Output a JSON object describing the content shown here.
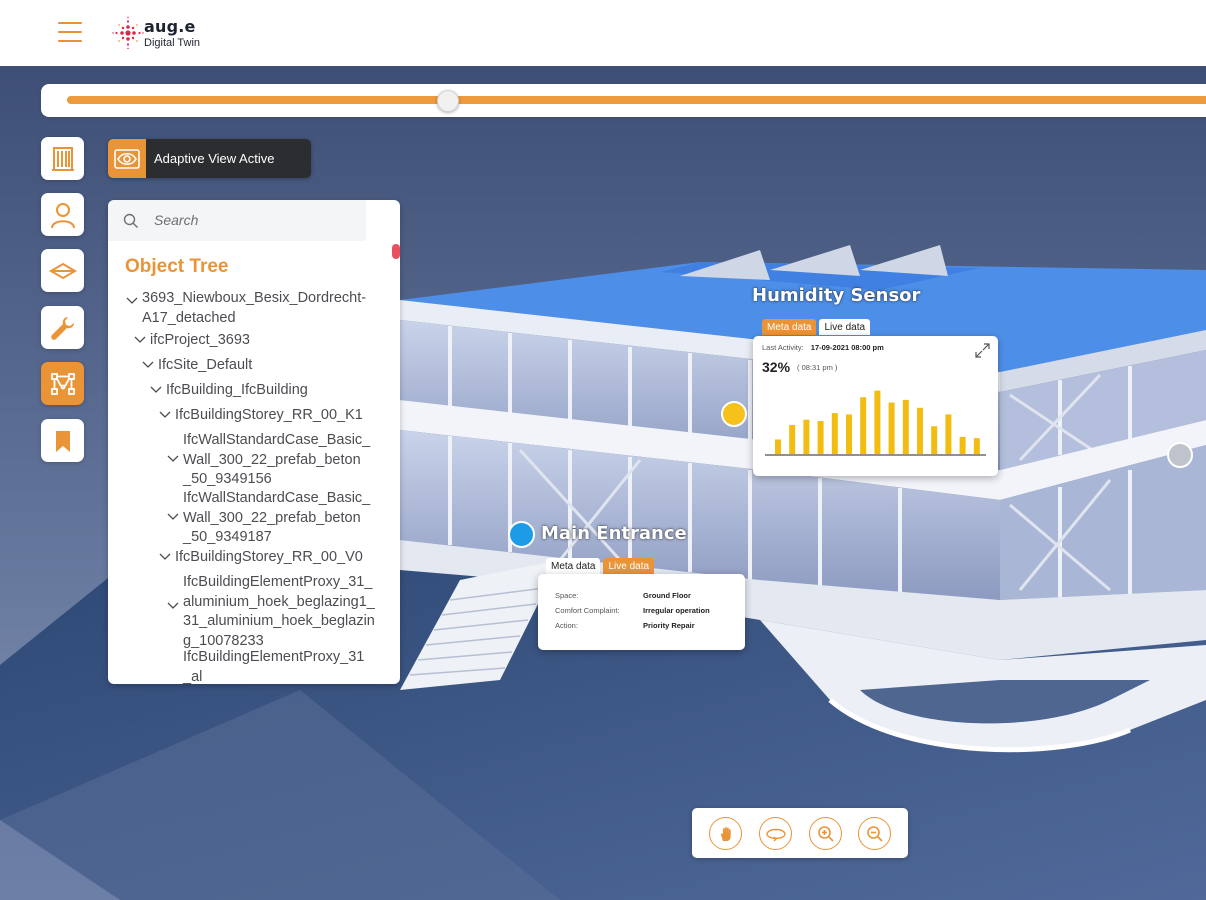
{
  "header": {
    "menu_icon": "hamburger-icon",
    "brand_name": "aug.e",
    "brand_subtitle": "Digital Twin",
    "brand_color": "#ea9438"
  },
  "timeline": {
    "position_fraction": 0.33,
    "track_color": "#ec9a3c"
  },
  "toolbar": {
    "items": [
      {
        "icon": "building-icon",
        "active": false
      },
      {
        "icon": "user-icon",
        "active": false
      },
      {
        "icon": "layers-icon",
        "active": false
      },
      {
        "icon": "wrench-icon",
        "active": false
      },
      {
        "icon": "network-icon",
        "active": true
      },
      {
        "icon": "bookmark-icon",
        "active": false
      }
    ]
  },
  "adaptive_view": {
    "icon": "eye-icon",
    "label": "Adaptive View Active"
  },
  "object_tree": {
    "search_placeholder": "Search",
    "title": "Object Tree",
    "nodes": [
      {
        "lines": [
          "3693_Niewboux_Besix_Dordrecht-",
          "A17_detached"
        ],
        "depth": 0,
        "expanded": true
      },
      {
        "lines": [
          "ifcProject_3693"
        ],
        "depth": 1,
        "expanded": true
      },
      {
        "lines": [
          "IfcSite_Default"
        ],
        "depth": 2,
        "expanded": true
      },
      {
        "lines": [
          "IfcBuilding_IfcBuilding"
        ],
        "depth": 3,
        "expanded": true
      },
      {
        "lines": [
          "IfcBuildingStorey_RR_00_K1"
        ],
        "depth": 4,
        "expanded": true
      },
      {
        "lines": [
          "IfcWallStandardCase_Basic_",
          "Wall_300_22_prefab_beton",
          "_50_9349156"
        ],
        "depth": 5,
        "expanded": true
      },
      {
        "lines": [
          "IfcWallStandardCase_Basic_",
          "Wall_300_22_prefab_beton",
          "_50_9349187"
        ],
        "depth": 5,
        "expanded": true
      },
      {
        "lines": [
          "IfcBuildingStorey_RR_00_V0"
        ],
        "depth": 4,
        "expanded": true
      },
      {
        "lines": [
          "IfcBuildingElementProxy_31_",
          "aluminium_hoek_beglazing1_",
          "31_aluminium_hoek_beglazin",
          "g_10078233"
        ],
        "depth": 5,
        "expanded": true
      },
      {
        "lines": [
          "IfcBuildingElementProxy_31",
          "_al"
        ],
        "depth": 5,
        "expanded": false
      }
    ]
  },
  "humidity_sensor": {
    "title": "Humidity Sensor",
    "tab_meta": "Meta data",
    "tab_live": "Live data",
    "active_tab": "meta",
    "last_activity_label": "Last Activity:",
    "last_activity_value": "17-09-2021 08:00 pm",
    "value": "32%",
    "time": "( 08:31 pm )",
    "expand_icon": "expand-icon",
    "marker_color": "#f5c21b",
    "bar_color": "#f2bc13"
  },
  "chart_data": {
    "type": "bar",
    "values": [
      2.2,
      4.4,
      5.2,
      5.0,
      6.2,
      6.0,
      8.6,
      9.6,
      7.8,
      8.2,
      7.0,
      4.2,
      6.0,
      2.6,
      2.4,
      2.4
    ]
  },
  "main_entrance": {
    "title": "Main Entrance",
    "tab_meta": "Meta data",
    "tab_live": "Live data",
    "active_tab": "live",
    "marker_color": "#1e9be6",
    "rows": [
      {
        "label": "Space:",
        "value": "Ground Floor"
      },
      {
        "label": "Comfort Complaint:",
        "value": "Irregular operation"
      },
      {
        "label": "Action:",
        "value": "Priority Repair"
      }
    ]
  },
  "navigation": {
    "buttons": [
      "pan-hand-icon",
      "orbit-icon",
      "zoom-in-icon",
      "zoom-out-icon"
    ]
  }
}
